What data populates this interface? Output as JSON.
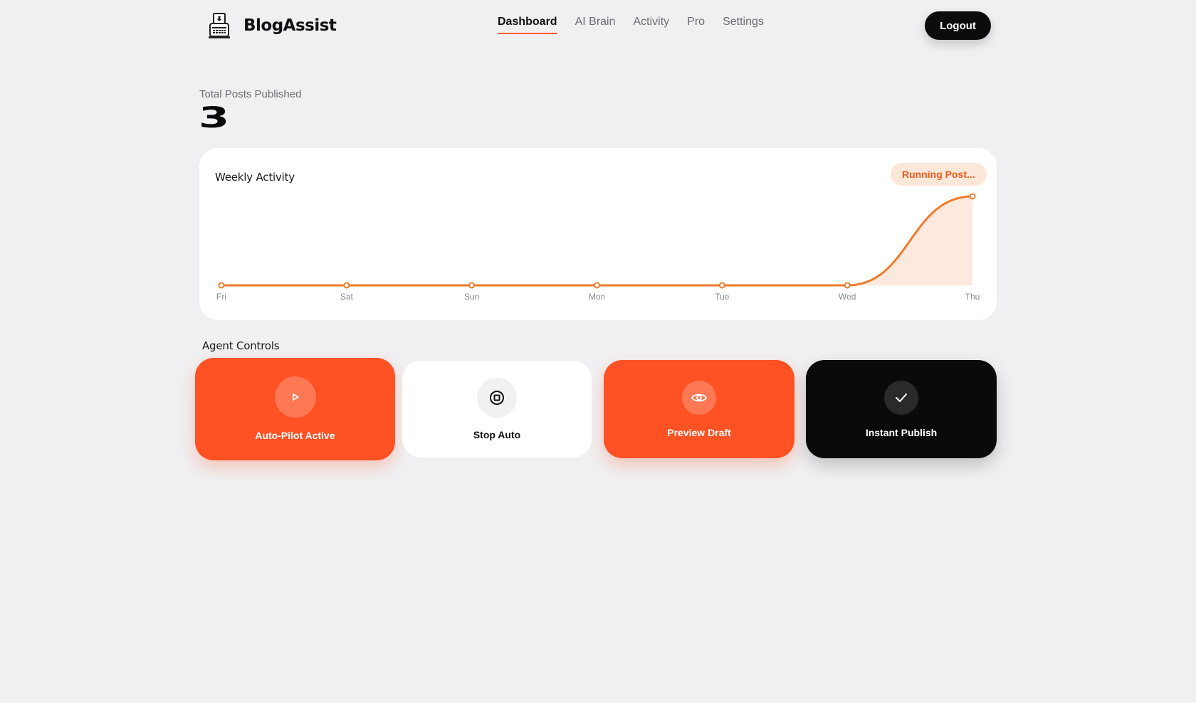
{
  "header": {
    "brand": "BlogAssist",
    "logo_icon": "typewriter-icon",
    "nav": [
      {
        "label": "Dashboard",
        "active": true
      },
      {
        "label": "AI Brain",
        "active": false
      },
      {
        "label": "Activity",
        "active": false
      },
      {
        "label": "Pro",
        "active": false
      },
      {
        "label": "Settings",
        "active": false
      }
    ],
    "logout_label": "Logout"
  },
  "stats": {
    "total_posts_label": "Total Posts Published",
    "total_posts_value": "3"
  },
  "chart": {
    "title": "Weekly Activity",
    "badge": "Running Post..."
  },
  "chart_data": {
    "type": "area",
    "title": "Weekly Activity",
    "categories": [
      "Fri",
      "Sat",
      "Sun",
      "Mon",
      "Tue",
      "Wed",
      "Thu"
    ],
    "values": [
      0,
      0,
      0,
      0,
      0,
      0,
      3
    ],
    "ylim": [
      0,
      3
    ],
    "grid": false,
    "line_color": "#f07b2c",
    "fill_color": "#fde5d8"
  },
  "controls": {
    "title": "Agent Controls",
    "items": [
      {
        "label": "Auto-Pilot Active",
        "icon": "play-icon"
      },
      {
        "label": "Stop Auto",
        "icon": "stop-icon"
      },
      {
        "label": "Preview Draft",
        "icon": "eye-icon"
      },
      {
        "label": "Instant Publish",
        "icon": "check-icon"
      }
    ]
  },
  "colors": {
    "accent": "#ff5224",
    "dark": "#0a0a0a",
    "background": "#f0f0f2"
  }
}
